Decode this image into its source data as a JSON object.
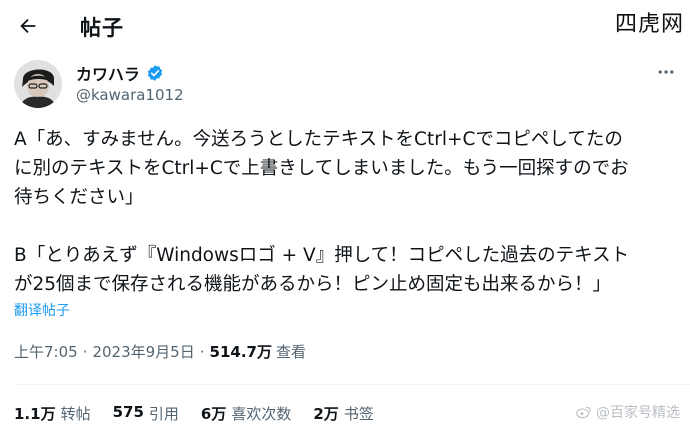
{
  "header": {
    "title": "帖子",
    "site_mark": "四虎网"
  },
  "post": {
    "author_name": "カワハラ",
    "author_handle": "@kawara1012",
    "verified": true,
    "lines": [
      "A「あ、すみません。今送ろうとしたテキストをCtrl+Cでコピペしてたの",
      "に別のテキストをCtrl+Cで上書きしてしまいました。もう一回探すのでお",
      "待ちください」",
      "",
      "B「とりあえず『Windowsロゴ + V』押して！コピペした過去のテキスト",
      "が25個まで保存される機能があるから！ピン止め固定も出来るから！」"
    ],
    "translate_label": "翻译帖子",
    "time": "上午7:05",
    "date": "2023年9月5日",
    "views_count": "514.7万",
    "views_label": "查看"
  },
  "stats": [
    {
      "count": "1.1万",
      "label": "转帖"
    },
    {
      "count": "575",
      "label": "引用"
    },
    {
      "count": "6万",
      "label": "喜欢次数"
    },
    {
      "count": "2万",
      "label": "书签"
    }
  ],
  "watermark": {
    "text": "@百家号精选"
  },
  "colors": {
    "accent": "#1d9bf0",
    "text": "#0f1419",
    "secondary": "#536471"
  },
  "icons": {
    "back": "arrow-left-icon",
    "verified": "verified-badge-icon",
    "more": "more-dots-icon"
  }
}
